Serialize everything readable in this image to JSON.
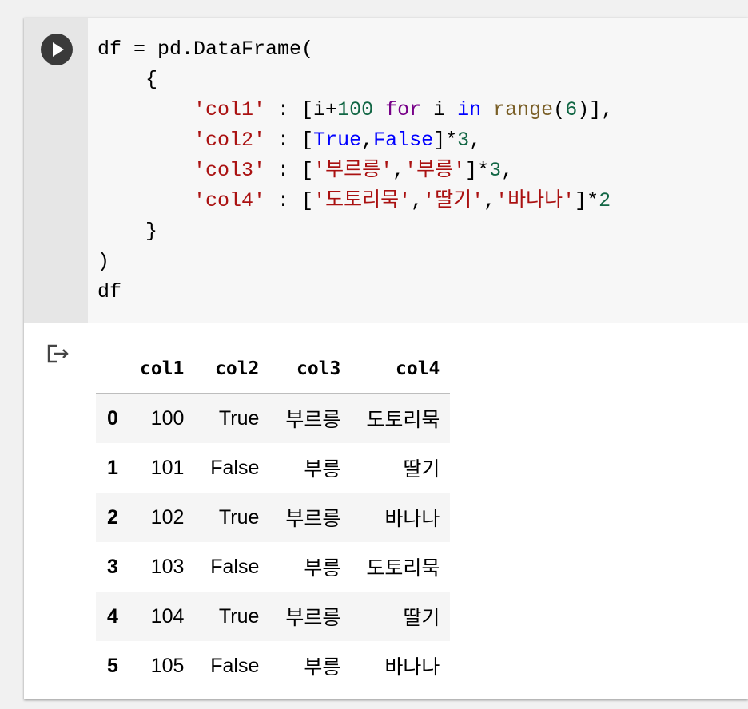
{
  "code": {
    "line1": {
      "a": "df = pd.DataFrame("
    },
    "line2": {
      "a": "    {"
    },
    "line3": {
      "s": "'col1'",
      "b": " : [i+",
      "n": "100",
      "kw1": "for",
      "c": " i ",
      "kw2": "in",
      "fn": "range",
      "d": "(",
      "n2": "6",
      "e": ")],"
    },
    "line4": {
      "s": "'col2'",
      "b": " : [",
      "t": "True",
      "c": ",",
      "f": "False",
      "d": "]*",
      "n": "3",
      "e": ","
    },
    "line5": {
      "s": "'col3'",
      "b": " : [",
      "s1": "'부르릉'",
      "c": ",",
      "s2": "'부릉'",
      "d": "]*",
      "n": "3",
      "e": ","
    },
    "line6": {
      "s": "'col4'",
      "b": " : [",
      "s1": "'도토리묵'",
      "c1": ",",
      "s2": "'딸기'",
      "c2": ",",
      "s3": "'바나나'",
      "d": "]*",
      "n": "2"
    },
    "line7": {
      "a": "    }"
    },
    "line8": {
      "a": ")"
    },
    "line9": {
      "a": "df"
    }
  },
  "colors": {
    "run_button": "#3a3a3a",
    "keyword": "#770088",
    "builtin": "#0000ff",
    "string": "#aa1111",
    "number": "#116644"
  },
  "icons": {
    "run": "play-icon",
    "output": "output-exit-icon"
  },
  "table": {
    "columns": [
      "col1",
      "col2",
      "col3",
      "col4"
    ],
    "rows": [
      {
        "index": "0",
        "col1": "100",
        "col2": "True",
        "col3": "부르릉",
        "col4": "도토리묵"
      },
      {
        "index": "1",
        "col1": "101",
        "col2": "False",
        "col3": "부릉",
        "col4": "딸기"
      },
      {
        "index": "2",
        "col1": "102",
        "col2": "True",
        "col3": "부르릉",
        "col4": "바나나"
      },
      {
        "index": "3",
        "col1": "103",
        "col2": "False",
        "col3": "부릉",
        "col4": "도토리묵"
      },
      {
        "index": "4",
        "col1": "104",
        "col2": "True",
        "col3": "부르릉",
        "col4": "딸기"
      },
      {
        "index": "5",
        "col1": "105",
        "col2": "False",
        "col3": "부릉",
        "col4": "바나나"
      }
    ]
  }
}
